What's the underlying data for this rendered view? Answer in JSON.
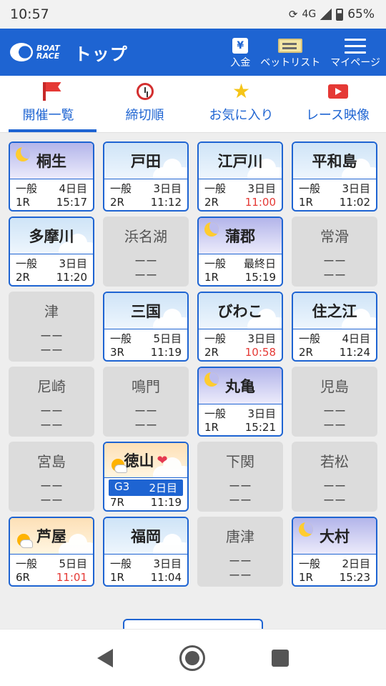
{
  "status_bar": {
    "time": "10:57",
    "network": "4G",
    "battery": "65%"
  },
  "header": {
    "logo_line1": "BOAT",
    "logo_line2": "RACE",
    "title": "トップ",
    "actions": [
      {
        "label": "入金",
        "icon": "deposit-icon"
      },
      {
        "label": "ベットリスト",
        "icon": "bet-list-icon"
      },
      {
        "label": "マイページ",
        "icon": "menu-icon"
      }
    ]
  },
  "tabs": [
    {
      "label": "開催一覧",
      "icon": "flag-icon",
      "active": true
    },
    {
      "label": "締切順",
      "icon": "alarm-clock-icon",
      "active": false
    },
    {
      "label": "お気に入り",
      "icon": "star-icon",
      "active": false
    },
    {
      "label": "レース映像",
      "icon": "video-icon",
      "active": false
    }
  ],
  "venues": [
    {
      "name": "桐生",
      "open": true,
      "theme": "night",
      "grade": "一般",
      "day": "4日目",
      "race": "1R",
      "time": "15:17",
      "late": false
    },
    {
      "name": "戸田",
      "open": true,
      "theme": "day",
      "grade": "一般",
      "day": "3日目",
      "race": "2R",
      "time": "11:12",
      "late": false
    },
    {
      "name": "江戸川",
      "open": true,
      "theme": "day",
      "grade": "一般",
      "day": "3日目",
      "race": "2R",
      "time": "11:00",
      "late": true
    },
    {
      "name": "平和島",
      "open": true,
      "theme": "day",
      "grade": "一般",
      "day": "3日目",
      "race": "1R",
      "time": "11:02",
      "late": false
    },
    {
      "name": "多摩川",
      "open": true,
      "theme": "day",
      "grade": "一般",
      "day": "3日目",
      "race": "2R",
      "time": "11:20",
      "late": false
    },
    {
      "name": "浜名湖",
      "open": false,
      "line1": "ーー",
      "line2": "ーー"
    },
    {
      "name": "蒲郡",
      "open": true,
      "theme": "night",
      "grade": "一般",
      "day": "最終日",
      "race": "1R",
      "time": "15:19",
      "late": false
    },
    {
      "name": "常滑",
      "open": false,
      "line1": "ーー",
      "line2": "ーー"
    },
    {
      "name": "津",
      "open": false,
      "line1": "ーー",
      "line2": "ーー"
    },
    {
      "name": "三国",
      "open": true,
      "theme": "day",
      "grade": "一般",
      "day": "5日目",
      "race": "3R",
      "time": "11:19",
      "late": false
    },
    {
      "name": "びわこ",
      "open": true,
      "theme": "day",
      "grade": "一般",
      "day": "3日目",
      "race": "2R",
      "time": "10:58",
      "late": true
    },
    {
      "name": "住之江",
      "open": true,
      "theme": "day",
      "grade": "一般",
      "day": "4日目",
      "race": "2R",
      "time": "11:24",
      "late": false
    },
    {
      "name": "尼崎",
      "open": false,
      "line1": "ーー",
      "line2": "ーー"
    },
    {
      "name": "鳴門",
      "open": false,
      "line1": "ーー",
      "line2": "ーー"
    },
    {
      "name": "丸亀",
      "open": true,
      "theme": "night",
      "grade": "一般",
      "day": "3日目",
      "race": "1R",
      "time": "15:21",
      "late": false
    },
    {
      "name": "児島",
      "open": false,
      "line1": "ーー",
      "line2": "ーー"
    },
    {
      "name": "宮島",
      "open": false,
      "line1": "ーー",
      "line2": "ーー"
    },
    {
      "name": "徳山",
      "open": true,
      "theme": "dawn",
      "favorite": true,
      "grade": "G3",
      "day": "2日目",
      "race": "7R",
      "time": "11:19",
      "late": false
    },
    {
      "name": "下関",
      "open": false,
      "line1": "ーー",
      "line2": "ーー"
    },
    {
      "name": "若松",
      "open": false,
      "line1": "ーー",
      "line2": "ーー"
    },
    {
      "name": "芦屋",
      "open": true,
      "theme": "dawn",
      "grade": "一般",
      "day": "5日目",
      "race": "6R",
      "time": "11:01",
      "late": true
    },
    {
      "name": "福岡",
      "open": true,
      "theme": "day",
      "grade": "一般",
      "day": "3日目",
      "race": "1R",
      "time": "11:04",
      "late": false
    },
    {
      "name": "唐津",
      "open": false,
      "line1": "ーー",
      "line2": "ーー"
    },
    {
      "name": "大村",
      "open": true,
      "theme": "night",
      "grade": "一般",
      "day": "2日目",
      "race": "1R",
      "time": "15:23",
      "late": false
    }
  ],
  "colors": {
    "brand": "#1e64d2",
    "late": "#e53935",
    "closed": "#dcdcdc"
  }
}
